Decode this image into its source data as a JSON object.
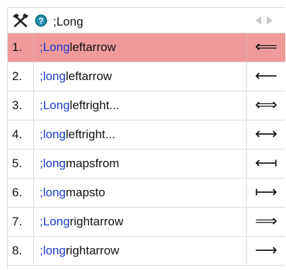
{
  "header": {
    "query": ";Long",
    "icons": {
      "tools": "tools-icon",
      "help": "help-icon",
      "prev": "arrow-left-icon",
      "next": "arrow-right-icon"
    }
  },
  "colors": {
    "selected_row": "#f19a9a",
    "match_text": "#1a3bd1",
    "grid_line": "#dcdcdc"
  },
  "selected_index": 0,
  "results": [
    {
      "num": "1.",
      "match": ";Long",
      "rest": "leftarrow",
      "glyph": "⟸"
    },
    {
      "num": "2.",
      "match": ";long",
      "rest": "leftarrow",
      "glyph": "⟵"
    },
    {
      "num": "3.",
      "match": ";Long",
      "rest": "leftright...",
      "glyph": "⟺"
    },
    {
      "num": "4.",
      "match": ";long",
      "rest": "leftright...",
      "glyph": "⟷"
    },
    {
      "num": "5.",
      "match": ";long",
      "rest": "mapsfrom",
      "glyph": "⟻"
    },
    {
      "num": "6.",
      "match": ";long",
      "rest": "mapsto",
      "glyph": "⟼"
    },
    {
      "num": "7.",
      "match": ";Long",
      "rest": "rightarrow",
      "glyph": "⟹"
    },
    {
      "num": "8.",
      "match": ";long",
      "rest": "rightarrow",
      "glyph": "⟶"
    }
  ]
}
